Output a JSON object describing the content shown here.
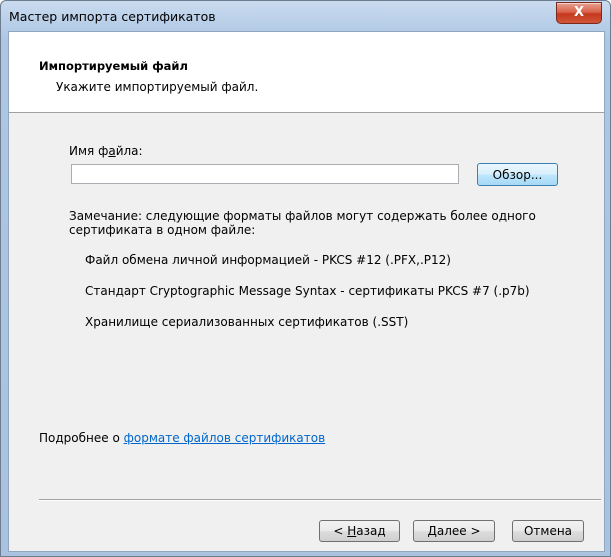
{
  "window": {
    "title": "Мастер импорта сертификатов",
    "close_label": "X"
  },
  "header": {
    "title": "Импортируемый файл",
    "subtitle": "Укажите импортируемый файл."
  },
  "file": {
    "label_pre": "Имя ф",
    "label_accel": "а",
    "label_post": "йла:",
    "value": "",
    "browse_label": "Обзор..."
  },
  "note": {
    "text": "Замечание: следующие форматы файлов могут содержать более одного сертификата в одном файле:",
    "formats": [
      "Файл обмена личной информацией - PKCS #12 (.PFX,.P12)",
      "Стандарт Cryptographic Message Syntax - сертификаты PKCS #7 (.p7b)",
      "Хранилище сериализованных сертификатов (.SST)"
    ]
  },
  "more": {
    "prefix": "Подробнее о ",
    "link": "формате файлов сертификатов"
  },
  "buttons": {
    "back_pre": "< ",
    "back_accel": "Н",
    "back_post": "азад",
    "next_accel": "Д",
    "next_post": "алее >",
    "cancel": "Отмена"
  }
}
